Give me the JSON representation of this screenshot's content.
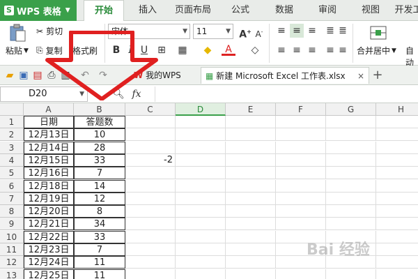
{
  "app": {
    "title": "WPS 表格",
    "logo": "S"
  },
  "ribbon_tabs": [
    "开始",
    "插入",
    "页面布局",
    "公式",
    "数据",
    "审阅",
    "视图",
    "开发工"
  ],
  "ribbon": {
    "paste": "粘贴",
    "cut": "剪切",
    "copy": "复制",
    "format_painter": "格式刷",
    "font_name": "宋体",
    "font_size": "11",
    "merge_center": "合并居中",
    "auto_wrap": "自动"
  },
  "doc_tabs": [
    "我的WPS",
    "新建 Microsoft Excel 工作表.xlsx"
  ],
  "formula_bar": {
    "name_box": "D20",
    "fx": "fx"
  },
  "columns": [
    "A",
    "B",
    "C",
    "D",
    "E",
    "F",
    "G",
    "H"
  ],
  "selected_column": "D",
  "rows": [
    {
      "n": "1",
      "a": "日期",
      "b": "答题数",
      "c": ""
    },
    {
      "n": "2",
      "a": "12月13日",
      "b": "10",
      "c": ""
    },
    {
      "n": "3",
      "a": "12月14日",
      "b": "28",
      "c": ""
    },
    {
      "n": "4",
      "a": "12月15日",
      "b": "33",
      "c": "-2"
    },
    {
      "n": "5",
      "a": "12月16日",
      "b": "7",
      "c": ""
    },
    {
      "n": "6",
      "a": "12月18日",
      "b": "14",
      "c": ""
    },
    {
      "n": "7",
      "a": "12月19日",
      "b": "12",
      "c": ""
    },
    {
      "n": "8",
      "a": "12月20日",
      "b": "8",
      "c": ""
    },
    {
      "n": "9",
      "a": "12月21日",
      "b": "34",
      "c": ""
    },
    {
      "n": "10",
      "a": "12月22日",
      "b": "33",
      "c": ""
    },
    {
      "n": "11",
      "a": "12月23日",
      "b": "7",
      "c": ""
    },
    {
      "n": "12",
      "a": "12月24日",
      "b": "11",
      "c": ""
    },
    {
      "n": "13",
      "a": "12月25日",
      "b": "11",
      "c": ""
    }
  ],
  "colors": {
    "accent": "#3aa04a",
    "arrow": "#e02020",
    "wps_red": "#d9302c"
  },
  "watermark": "Bai 经验"
}
